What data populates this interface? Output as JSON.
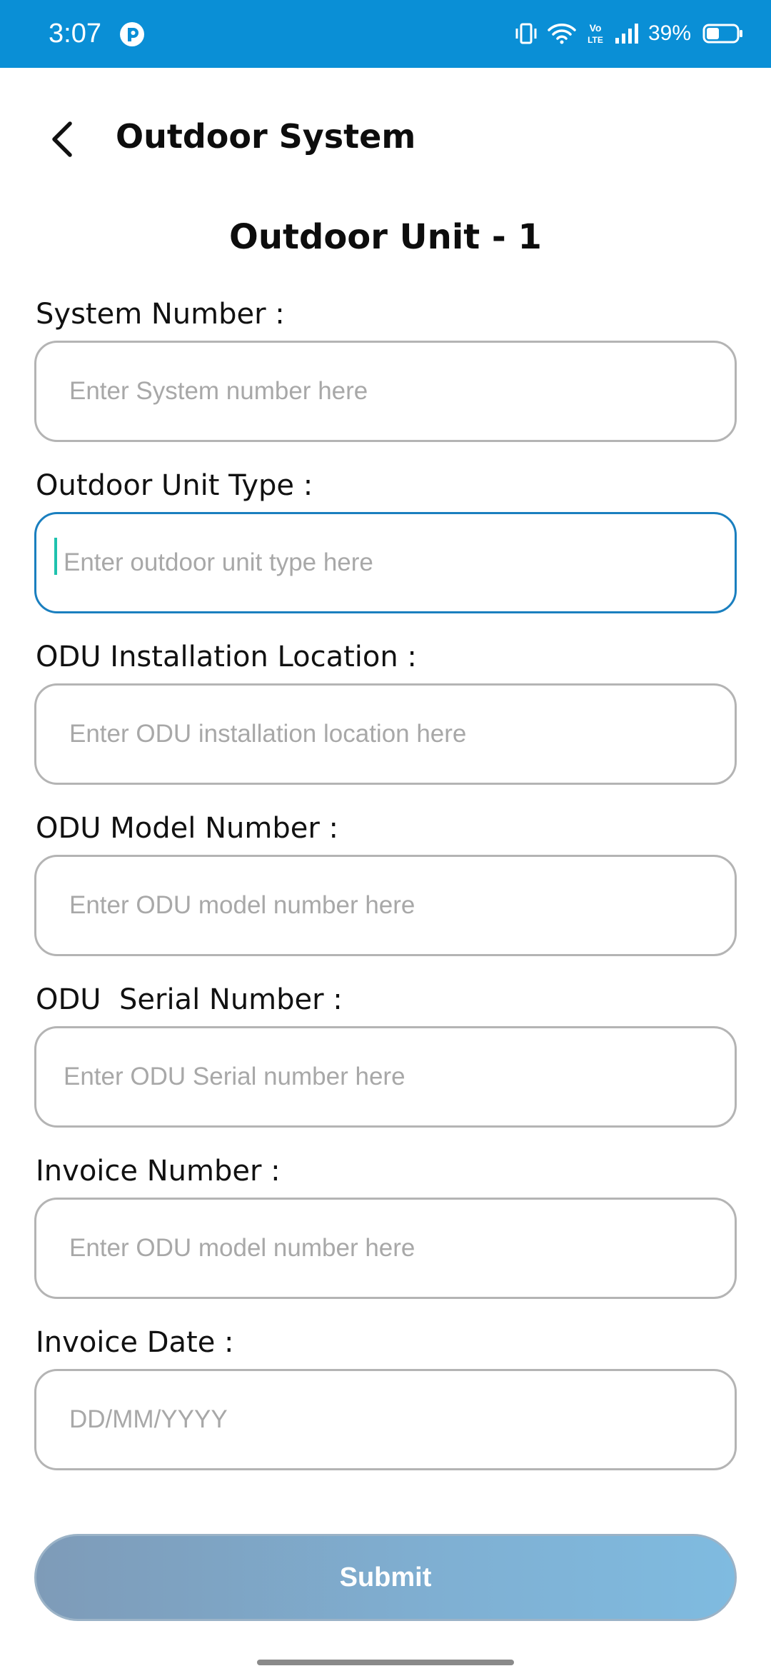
{
  "status_bar": {
    "time": "3:07",
    "battery_percent": "39%",
    "network_label": "Vo LTE",
    "icons": [
      "app-notification-icon",
      "vibrate-icon",
      "wifi-icon",
      "volte-icon",
      "signal-icon",
      "battery-icon"
    ]
  },
  "header": {
    "title": "Outdoor System",
    "back_icon": "chevron-left-icon"
  },
  "section": {
    "title": "Outdoor Unit - 1"
  },
  "form": {
    "fields": [
      {
        "label": "System Number :",
        "placeholder": "Enter System number here",
        "value": ""
      },
      {
        "label": "Outdoor Unit Type :",
        "placeholder": "Enter outdoor unit type here",
        "value": "",
        "focused": true
      },
      {
        "label": "ODU Installation Location :",
        "placeholder": "Enter ODU installation location here",
        "value": ""
      },
      {
        "label": "ODU Model Number :",
        "placeholder": "Enter ODU model number here",
        "value": ""
      },
      {
        "label": "ODU  Serial Number :",
        "placeholder": "Enter ODU Serial number here",
        "value": ""
      },
      {
        "label": "Invoice Number :",
        "placeholder": "Enter ODU model number here",
        "value": ""
      },
      {
        "label": "Invoice Date :",
        "placeholder": "DD/MM/YYYY",
        "value": ""
      }
    ],
    "submit_label": "Submit"
  },
  "colors": {
    "status_bar": "#0a8fd6",
    "focus_border": "#1a7fbf",
    "cursor": "#1fc2ae",
    "submit_gradient_start": "#7e9bb8",
    "submit_gradient_end": "#7fbbe0"
  }
}
